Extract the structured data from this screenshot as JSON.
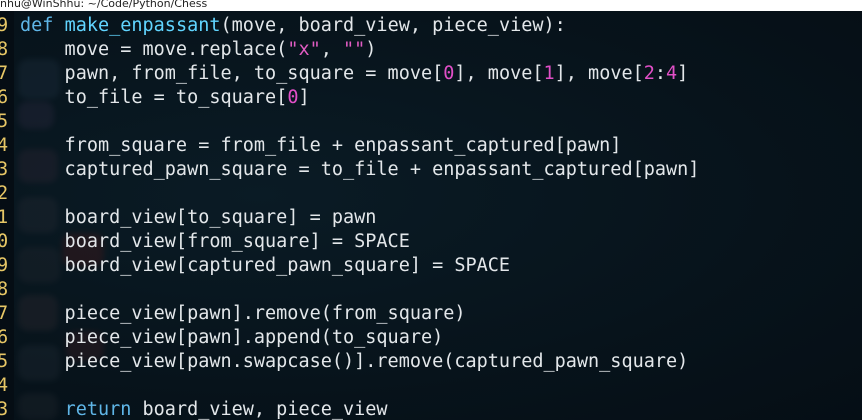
{
  "window": {
    "title": "nhu@WinShhu: ~/Code/Python/Chess"
  },
  "editor": {
    "lines": [
      {
        "number": "9",
        "tokens": [
          {
            "text": "def ",
            "kind": "keyword"
          },
          {
            "text": "make_enpassant",
            "kind": "function"
          },
          {
            "text": "(move, board_view, piece_view):",
            "kind": "plain"
          }
        ]
      },
      {
        "number": "8",
        "tokens": [
          {
            "text": "    move = move.replace(",
            "kind": "plain"
          },
          {
            "text": "\"x\"",
            "kind": "string"
          },
          {
            "text": ", ",
            "kind": "plain"
          },
          {
            "text": "\"\"",
            "kind": "string"
          },
          {
            "text": ")",
            "kind": "plain"
          }
        ]
      },
      {
        "number": "7",
        "tokens": [
          {
            "text": "    pawn, from_file, to_square = move[",
            "kind": "plain"
          },
          {
            "text": "0",
            "kind": "number"
          },
          {
            "text": "], move[",
            "kind": "plain"
          },
          {
            "text": "1",
            "kind": "number"
          },
          {
            "text": "], move[",
            "kind": "plain"
          },
          {
            "text": "2",
            "kind": "number"
          },
          {
            "text": ":",
            "kind": "plain"
          },
          {
            "text": "4",
            "kind": "number"
          },
          {
            "text": "]",
            "kind": "plain"
          }
        ]
      },
      {
        "number": "6",
        "tokens": [
          {
            "text": "    to_file = to_square[",
            "kind": "plain"
          },
          {
            "text": "0",
            "kind": "number"
          },
          {
            "text": "]",
            "kind": "plain"
          }
        ]
      },
      {
        "number": "5",
        "tokens": []
      },
      {
        "number": "4",
        "tokens": [
          {
            "text": "    from_square = from_file + enpassant_captured[pawn]",
            "kind": "plain"
          }
        ]
      },
      {
        "number": "3",
        "tokens": [
          {
            "text": "    captured_pawn_square = to_file + enpassant_captured[pawn]",
            "kind": "plain"
          }
        ]
      },
      {
        "number": "2",
        "tokens": []
      },
      {
        "number": "1",
        "tokens": [
          {
            "text": "    board_view[to_square] = pawn",
            "kind": "plain"
          }
        ]
      },
      {
        "number": "0",
        "tokens": [
          {
            "text": "    board_view[from_square] = SPACE",
            "kind": "plain"
          }
        ]
      },
      {
        "number": "9",
        "tokens": [
          {
            "text": "    board_view[captured_pawn_square] = SPACE",
            "kind": "plain"
          }
        ]
      },
      {
        "number": "8",
        "tokens": []
      },
      {
        "number": "7",
        "tokens": [
          {
            "text": "    piece_view[pawn].remove(from_square)",
            "kind": "plain"
          }
        ]
      },
      {
        "number": "6",
        "tokens": [
          {
            "text": "    piece_view[pawn].append(to_square)",
            "kind": "plain"
          }
        ]
      },
      {
        "number": "5",
        "tokens": [
          {
            "text": "    piece_view[pawn.swapcase()].remove(captured_pawn_square)",
            "kind": "plain"
          }
        ]
      },
      {
        "number": "4",
        "tokens": []
      },
      {
        "number": "3",
        "tokens": [
          {
            "text": "    ",
            "kind": "plain"
          },
          {
            "text": "return",
            "kind": "keyword"
          },
          {
            "text": " board_view, piece_view",
            "kind": "plain"
          }
        ]
      }
    ]
  }
}
